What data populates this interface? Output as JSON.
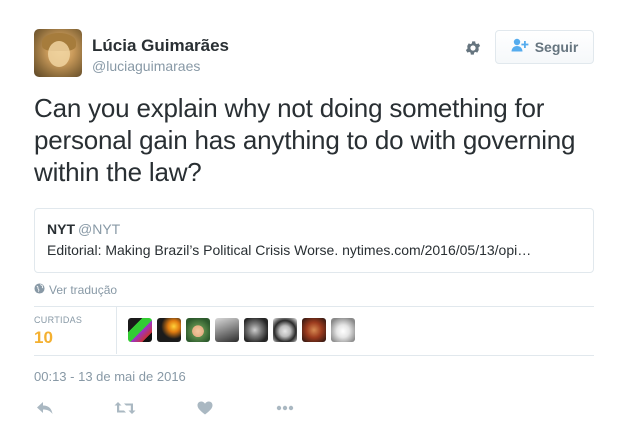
{
  "user": {
    "name": "Lúcia Guimarães",
    "handle": "@luciaguimaraes",
    "follow_label": "Seguir"
  },
  "tweet": {
    "text": "Can you explain why not doing something for personal gain has anything to do with governing within the law?"
  },
  "quote": {
    "name": "NYT",
    "handle": "@NYT",
    "text": "Editorial: Making Brazil’s Political Crisis Worse. nytimes.com/2016/05/13/opi…"
  },
  "translate_label": "Ver tradução",
  "stats": {
    "label": "CURTIDAS",
    "value": "10"
  },
  "liker_avatars": [
    {
      "name": "liker-avatar-1"
    },
    {
      "name": "liker-avatar-2"
    },
    {
      "name": "liker-avatar-3"
    },
    {
      "name": "liker-avatar-4"
    },
    {
      "name": "liker-avatar-5"
    },
    {
      "name": "liker-avatar-6"
    },
    {
      "name": "liker-avatar-7"
    },
    {
      "name": "liker-avatar-8"
    }
  ],
  "timestamp": "00:13 - 13 de mai de 2016",
  "icons": [
    "gear-icon",
    "add-user-icon",
    "globe-icon",
    "reply-icon",
    "retweet-icon",
    "like-icon",
    "more-icon"
  ],
  "colors": {
    "accent": "#f4b030",
    "muted": "#8899a6",
    "border": "#e1e8ed",
    "text": "#292f33"
  }
}
